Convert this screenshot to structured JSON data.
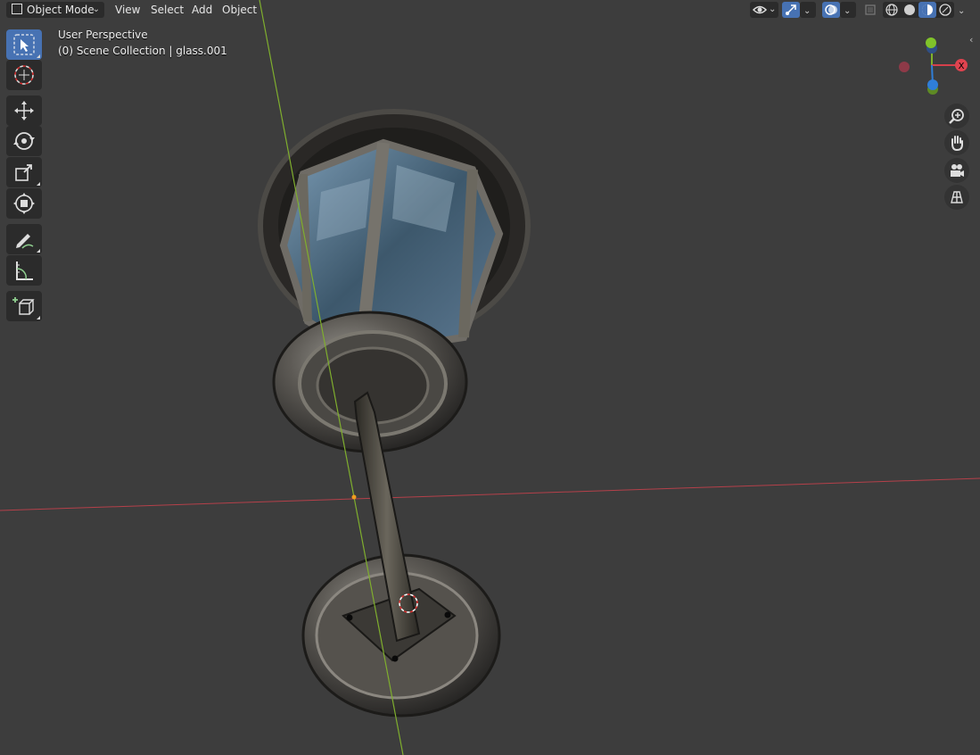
{
  "header": {
    "mode_label": "Object Mode",
    "menu": [
      "View",
      "Select",
      "Add",
      "Object"
    ]
  },
  "overlay": {
    "view_name": "User Perspective",
    "collection_info": "(0) Scene Collection | glass.001"
  },
  "gizmo": {
    "axis_x_label": "X",
    "axis_y_label": "Y",
    "axis_z_label": "Z"
  },
  "toolbar": {
    "tools": [
      "select-box-icon",
      "cursor-icon",
      "move-icon",
      "rotate-icon",
      "scale-icon",
      "transform-icon",
      "annotate-icon",
      "measure-icon",
      "add-cube-icon"
    ],
    "active_tool": "select-box-icon"
  },
  "navigation": {
    "buttons": [
      "zoom-icon",
      "hand-pan-icon",
      "camera-icon",
      "ortho-grid-icon"
    ]
  },
  "colors": {
    "background": "#3d3d3d",
    "accent": "#4772b3",
    "axis_x": "#d6404b",
    "axis_y": "#80b32a",
    "axis_z": "#2f7ed8"
  }
}
